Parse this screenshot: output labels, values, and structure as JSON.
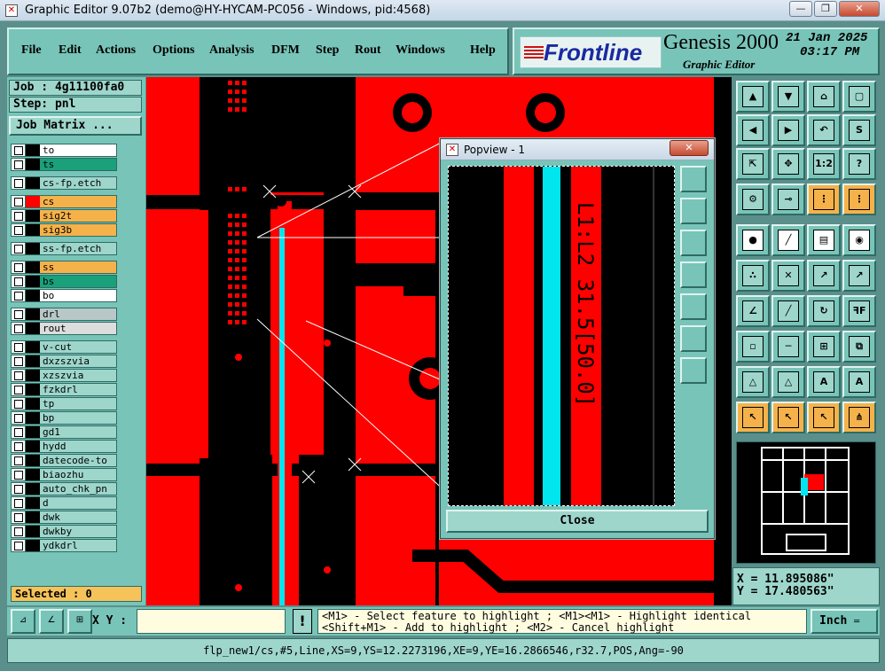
{
  "window": {
    "title": "Graphic Editor 9.07b2 (demo@HY-HYCAM-PC056 - Windows, pid:4568)"
  },
  "menu": {
    "items": [
      "File",
      "Edit",
      "Actions",
      "Options",
      "Analysis",
      "DFM",
      "Step",
      "Rout",
      "Windows",
      "Help"
    ]
  },
  "brand": {
    "logo": "Frontline",
    "product": "Genesis 2000",
    "subtitle": "Graphic Editor",
    "date": "21 Jan 2025",
    "time": "03:17 PM"
  },
  "job": {
    "job_label": "Job : 4g11100fa0",
    "step_label": "Step: pnl",
    "matrix_button": "Job Matrix ..."
  },
  "layers": [
    {
      "name": "to",
      "color": "#ffffff"
    },
    {
      "name": "ts",
      "color": "#1aa07a"
    },
    {
      "name": "cs-fp.etch",
      "color": "#9ed6cc"
    },
    {
      "name": "cs",
      "color": "#f6b24a"
    },
    {
      "name": "sig2t",
      "color": "#f6b24a"
    },
    {
      "name": "sig3b",
      "color": "#f6b24a"
    },
    {
      "name": "ss-fp.etch",
      "color": "#9ed6cc"
    },
    {
      "name": "ss",
      "color": "#f6b24a"
    },
    {
      "name": "bs",
      "color": "#1aa07a"
    },
    {
      "name": "bo",
      "color": "#ffffff"
    },
    {
      "name": "drl",
      "color": "#b8c8c8"
    },
    {
      "name": "rout",
      "color": "#dddddd"
    },
    {
      "name": "v-cut",
      "color": "#9ed6cc"
    },
    {
      "name": "dxzszvia",
      "color": "#9ed6cc"
    },
    {
      "name": "xzszvia",
      "color": "#9ed6cc"
    },
    {
      "name": "fzkdrl",
      "color": "#9ed6cc"
    },
    {
      "name": "tp",
      "color": "#9ed6cc"
    },
    {
      "name": "bp",
      "color": "#9ed6cc"
    },
    {
      "name": "gd1",
      "color": "#9ed6cc"
    },
    {
      "name": "hydd",
      "color": "#9ed6cc"
    },
    {
      "name": "datecode-to",
      "color": "#9ed6cc"
    },
    {
      "name": "biaozhu",
      "color": "#9ed6cc"
    },
    {
      "name": "auto_chk_pn",
      "color": "#9ed6cc"
    },
    {
      "name": "d",
      "color": "#9ed6cc"
    },
    {
      "name": "dwk",
      "color": "#9ed6cc"
    },
    {
      "name": "dwkby",
      "color": "#9ed6cc"
    },
    {
      "name": "ydkdrl",
      "color": "#9ed6cc"
    }
  ],
  "selected": "Selected : 0",
  "popview": {
    "title": "Popview - 1",
    "label": "L1:L2 31.5[50.0]",
    "close": "Close"
  },
  "coords": {
    "x": "X = 11.895086\"",
    "y": "Y = 17.480563\""
  },
  "toolbar_labels": {
    "ratio": "1:2",
    "help": "?"
  },
  "status": {
    "xy_label": "X Y :",
    "bang": "!",
    "hint_line1": "<M1> - Select feature to highlight ; <M1><M1> - Highlight identical",
    "hint_line2": "<Shift+M1> - Add to highlight ; <M2> - Cancel highlight",
    "units": "Inch"
  },
  "info": "flp_new1/cs,#5,Line,XS=9,YS=12.2273196,XE=9,YE=16.2866546,r32.7,POS,Ang=-90",
  "colors": {
    "copper": "#ff0000",
    "highlight": "#00e5ee",
    "panel": "#78c4b8",
    "accent": "#f6b24a"
  }
}
